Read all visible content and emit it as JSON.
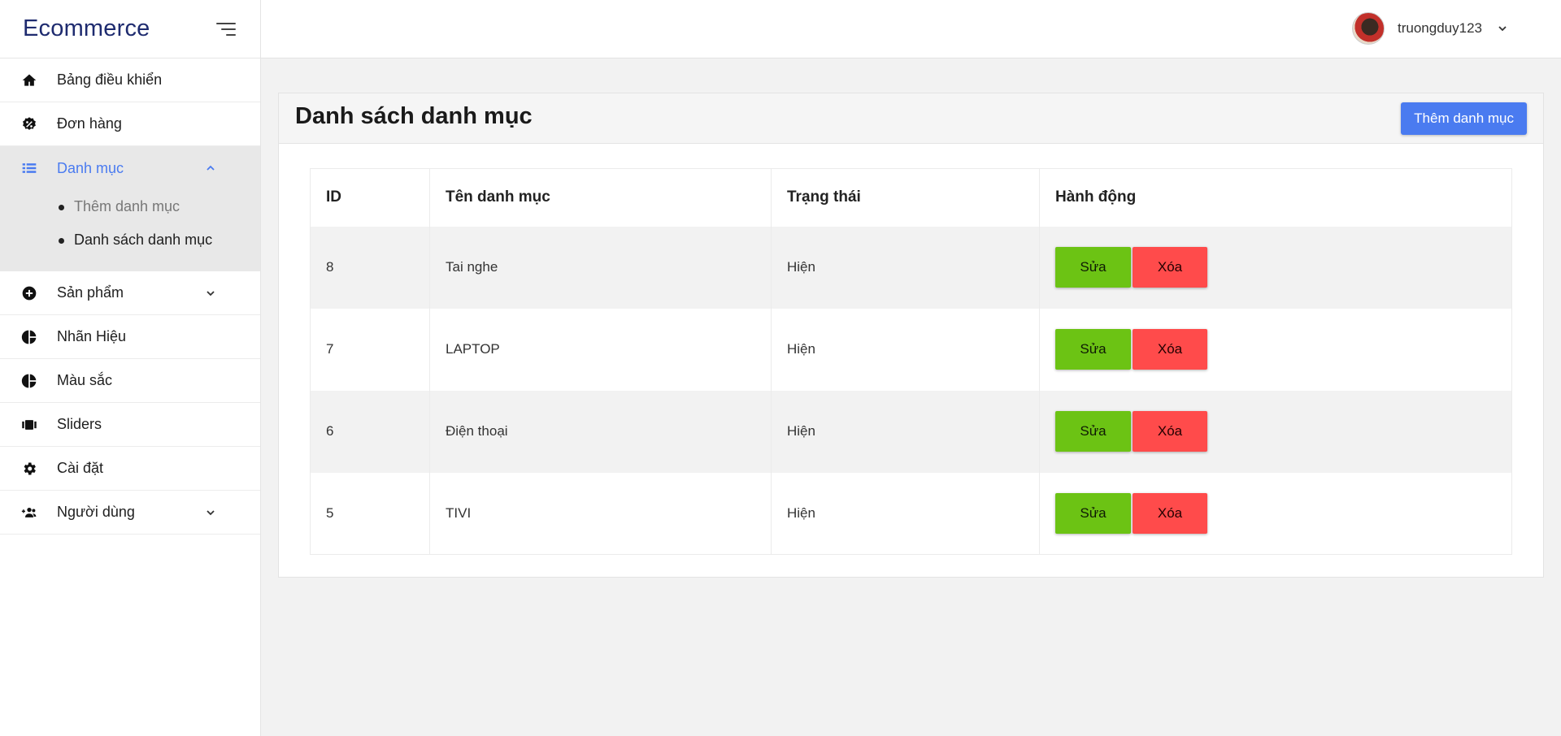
{
  "brand": {
    "title": "Ecommerce"
  },
  "sidebar": {
    "items": [
      {
        "label": "Bảng điều khiển",
        "icon": "home-icon"
      },
      {
        "label": "Đơn hàng",
        "icon": "badge-percent-icon"
      },
      {
        "label": "Danh mục",
        "icon": "list-icon",
        "expanded": true,
        "children": [
          {
            "label": "Thêm danh mục"
          },
          {
            "label": "Danh sách danh mục"
          }
        ]
      },
      {
        "label": "Sản phẩm",
        "icon": "plus-circle-icon"
      },
      {
        "label": "Nhãn Hiệu",
        "icon": "pie-chart-icon"
      },
      {
        "label": "Màu sắc",
        "icon": "pie-chart-icon"
      },
      {
        "label": "Sliders",
        "icon": "carousel-icon"
      },
      {
        "label": "Cài đặt",
        "icon": "gear-icon"
      },
      {
        "label": "Người dùng",
        "icon": "add-user-icon"
      }
    ]
  },
  "header": {
    "username": "truongduy123"
  },
  "main": {
    "title": "Danh sách danh mục",
    "add_button": "Thêm danh mục",
    "table": {
      "columns": [
        "ID",
        "Tên danh mục",
        "Trạng thái",
        "Hành động"
      ],
      "rows": [
        {
          "id": "8",
          "name": "Tai nghe",
          "status": "Hiện"
        },
        {
          "id": "7",
          "name": "LAPTOP",
          "status": "Hiện"
        },
        {
          "id": "6",
          "name": "Điện thoại",
          "status": "Hiện"
        },
        {
          "id": "5",
          "name": "TIVI",
          "status": "Hiện"
        }
      ],
      "edit_label": "Sửa",
      "delete_label": "Xóa"
    }
  },
  "colors": {
    "accent": "#4a7bf0",
    "edit": "#6cc314",
    "delete": "#ff4b4b",
    "brand": "#1e2b6f"
  }
}
